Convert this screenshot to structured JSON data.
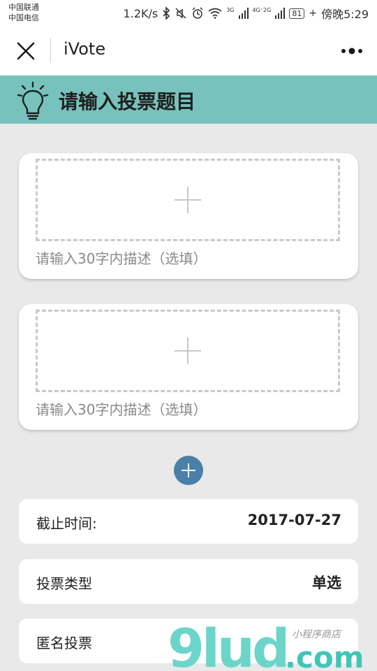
{
  "status_bar": {
    "carrier1": "中国联通",
    "carrier2": "中国电信",
    "speed": "1.2K/s",
    "signal1": "3G",
    "signal2": "4G⁺2G",
    "battery": "81",
    "time": "傍晚5:29"
  },
  "nav": {
    "title": "iVote"
  },
  "banner": {
    "title": "请输入投票题目"
  },
  "options": [
    {
      "placeholder": "请输入30字内描述（选填）"
    },
    {
      "placeholder": "请输入30字内描述（选填）"
    }
  ],
  "settings": {
    "deadline_label": "截止时间:",
    "deadline_value": "2017-07-27",
    "type_label": "投票类型",
    "type_value": "单选",
    "anonymous_label": "匿名投票"
  },
  "watermark": {
    "logo": "9lud",
    "domain": ".com",
    "tagline": "小程序商店"
  },
  "colors": {
    "banner": "#77c2bc",
    "accent": "#4a7fa7",
    "background": "#e9e9e9"
  }
}
